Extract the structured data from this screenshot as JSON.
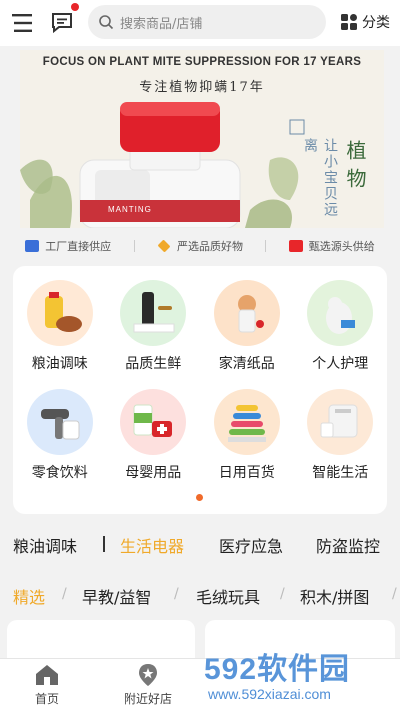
{
  "topbar": {
    "search_placeholder": "搜索商品/店铺",
    "category_label": "分类",
    "accent": "#e8262a"
  },
  "banner": {
    "headline_en": "FOCUS ON PLANT MITE SUPPRESSION FOR 17 YEARS",
    "headline_cn": "专注植物抑螨17年",
    "side_text": "植物",
    "side_text2": "让小宝贝远离",
    "brand": "MANTING"
  },
  "features": [
    {
      "label": "工厂直接供应",
      "icon": "factory-icon",
      "color": "#3a6fd8"
    },
    {
      "label": "严选品质好物",
      "icon": "diamond-icon",
      "color": "#f0a92a"
    },
    {
      "label": "甄选源头供给",
      "icon": "box-icon",
      "color": "#e8262a"
    }
  ],
  "categories": [
    {
      "label": "粮油调味",
      "bg": "#ffe9d6"
    },
    {
      "label": "品质生鲜",
      "bg": "#dff3df"
    },
    {
      "label": "家清纸品",
      "bg": "#fde2c9"
    },
    {
      "label": "个人护理",
      "bg": "#e3f3dc"
    },
    {
      "label": "零食饮料",
      "bg": "#dbe9fb"
    },
    {
      "label": "母婴用品",
      "bg": "#fde0de"
    },
    {
      "label": "日用百货",
      "bg": "#fde6cf"
    },
    {
      "label": "智能生活",
      "bg": "#fde9d7"
    }
  ],
  "subtabs": [
    "粮油调味",
    "生活电器",
    "医疗应急",
    "防盗监控"
  ],
  "active_subtab": "生活电器",
  "filters": [
    "精选",
    "早教/益智",
    "毛绒玩具",
    "积木/拼图"
  ],
  "active_filter": "精选",
  "bottom_nav": [
    {
      "label": "首页",
      "icon": "home-icon"
    },
    {
      "label": "附近好店",
      "icon": "location-star-icon"
    }
  ],
  "watermark": {
    "title_num": "592",
    "title_cn": "软件园",
    "url": "www.592xiazai.com"
  }
}
